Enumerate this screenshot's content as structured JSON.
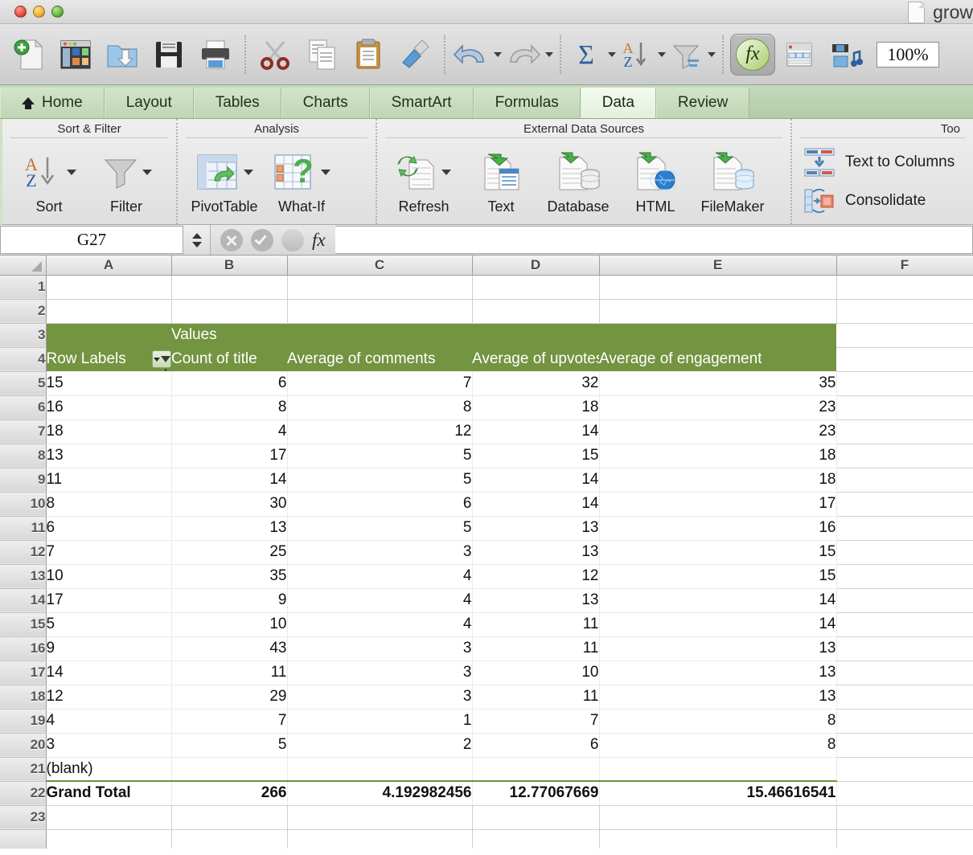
{
  "window": {
    "title": "grow",
    "controls": [
      "close",
      "minimize",
      "zoom"
    ]
  },
  "toolbar": {
    "buttons": [
      {
        "name": "new-document",
        "label": "New"
      },
      {
        "name": "open-gallery",
        "label": "Gallery"
      },
      {
        "name": "open-folder",
        "label": "Open"
      },
      {
        "name": "save",
        "label": "Save"
      },
      {
        "name": "print",
        "label": "Print"
      },
      {
        "name": "cut",
        "label": "Cut"
      },
      {
        "name": "copy",
        "label": "Copy"
      },
      {
        "name": "paste",
        "label": "Paste"
      },
      {
        "name": "format-painter",
        "label": "Format"
      },
      {
        "name": "undo",
        "label": "Undo"
      },
      {
        "name": "redo",
        "label": "Redo"
      },
      {
        "name": "autosum",
        "label": "AutoSum"
      },
      {
        "name": "sort",
        "label": "Sort"
      },
      {
        "name": "filter",
        "label": "Filter"
      },
      {
        "name": "formula-builder",
        "label": "fx"
      },
      {
        "name": "toolbox",
        "label": "Toolbox"
      },
      {
        "name": "media-browser",
        "label": "Media"
      }
    ],
    "zoom_value": "100%"
  },
  "ribbon": {
    "tabs": [
      {
        "label": "Home",
        "icon": "home-icon",
        "active": false
      },
      {
        "label": "Layout",
        "active": false
      },
      {
        "label": "Tables",
        "active": false
      },
      {
        "label": "Charts",
        "active": false
      },
      {
        "label": "SmartArt",
        "active": false
      },
      {
        "label": "Formulas",
        "active": false
      },
      {
        "label": "Data",
        "active": true
      },
      {
        "label": "Review",
        "active": false
      }
    ],
    "groups": [
      {
        "title": "Sort & Filter",
        "items": [
          {
            "label": "Sort",
            "icon": "sort-az-icon",
            "has_caret": true
          },
          {
            "label": "Filter",
            "icon": "funnel-icon",
            "has_caret": true
          }
        ]
      },
      {
        "title": "Analysis",
        "items": [
          {
            "label": "PivotTable",
            "icon": "pivot-table-icon",
            "has_caret": true
          },
          {
            "label": "What-If",
            "icon": "what-if-icon",
            "has_caret": true
          }
        ]
      },
      {
        "title": "External Data Sources",
        "items": [
          {
            "label": "Refresh",
            "icon": "refresh-icon",
            "has_caret": true
          },
          {
            "label": "Text",
            "icon": "import-text-icon",
            "has_caret": false
          },
          {
            "label": "Database",
            "icon": "import-database-icon",
            "has_caret": false
          },
          {
            "label": "HTML",
            "icon": "import-html-icon",
            "has_caret": false
          },
          {
            "label": "FileMaker",
            "icon": "import-filemaker-icon",
            "has_caret": false
          }
        ]
      },
      {
        "title": "Too",
        "stack": [
          {
            "label": "Text to Columns",
            "icon": "text-to-columns-icon"
          },
          {
            "label": "Consolidate",
            "icon": "consolidate-icon"
          }
        ]
      }
    ]
  },
  "formula_bar": {
    "name_box": "G27",
    "formula_value": "",
    "cancel_label": "Cancel",
    "accept_label": "Accept",
    "fx_label": "fx"
  },
  "grid": {
    "columns": [
      "A",
      "B",
      "C",
      "D",
      "E",
      "F"
    ],
    "row_numbers": [
      "1",
      "2",
      "3",
      "4",
      "5",
      "6",
      "7",
      "8",
      "9",
      "10",
      "11",
      "12",
      "13",
      "14",
      "15",
      "16",
      "17",
      "18",
      "19",
      "20",
      "21",
      "22",
      "23"
    ],
    "selected_cell": "G27"
  },
  "pivot": {
    "values_label": "Values",
    "row_labels": "Row Labels",
    "headers": [
      "Count of title",
      "Average of comments",
      "Average of upvotes",
      "Average of engagement"
    ],
    "rows": [
      {
        "row": "5",
        "label": "15",
        "values": [
          "6",
          "7",
          "32",
          "35"
        ]
      },
      {
        "row": "6",
        "label": "16",
        "values": [
          "8",
          "8",
          "18",
          "23"
        ]
      },
      {
        "row": "7",
        "label": "18",
        "values": [
          "4",
          "12",
          "14",
          "23"
        ]
      },
      {
        "row": "8",
        "label": "13",
        "values": [
          "17",
          "5",
          "15",
          "18"
        ]
      },
      {
        "row": "9",
        "label": "11",
        "values": [
          "14",
          "5",
          "14",
          "18"
        ]
      },
      {
        "row": "10",
        "label": "8",
        "values": [
          "30",
          "6",
          "14",
          "17"
        ]
      },
      {
        "row": "11",
        "label": "6",
        "values": [
          "13",
          "5",
          "13",
          "16"
        ]
      },
      {
        "row": "12",
        "label": "7",
        "values": [
          "25",
          "3",
          "13",
          "15"
        ]
      },
      {
        "row": "13",
        "label": "10",
        "values": [
          "35",
          "4",
          "12",
          "15"
        ]
      },
      {
        "row": "14",
        "label": "17",
        "values": [
          "9",
          "4",
          "13",
          "14"
        ]
      },
      {
        "row": "15",
        "label": "5",
        "values": [
          "10",
          "4",
          "11",
          "14"
        ]
      },
      {
        "row": "16",
        "label": "9",
        "values": [
          "43",
          "3",
          "11",
          "13"
        ]
      },
      {
        "row": "17",
        "label": "14",
        "values": [
          "11",
          "3",
          "10",
          "13"
        ]
      },
      {
        "row": "18",
        "label": "12",
        "values": [
          "29",
          "3",
          "11",
          "13"
        ]
      },
      {
        "row": "19",
        "label": "4",
        "values": [
          "7",
          "1",
          "7",
          "8"
        ]
      },
      {
        "row": "20",
        "label": "3",
        "values": [
          "5",
          "2",
          "6",
          "8"
        ]
      },
      {
        "row": "21",
        "label": "(blank)",
        "values": [
          "",
          "",
          "",
          ""
        ]
      }
    ],
    "grand_total": {
      "label": "Grand Total",
      "values": [
        "266",
        "4.192982456",
        "12.77067669",
        "15.46616541"
      ]
    }
  },
  "colors": {
    "pivot_header_green": "#739440",
    "tab_active": "#f4faf0",
    "tab_inactive": "#cfe1c6",
    "ribbon_bg": "#e6e6e6"
  }
}
